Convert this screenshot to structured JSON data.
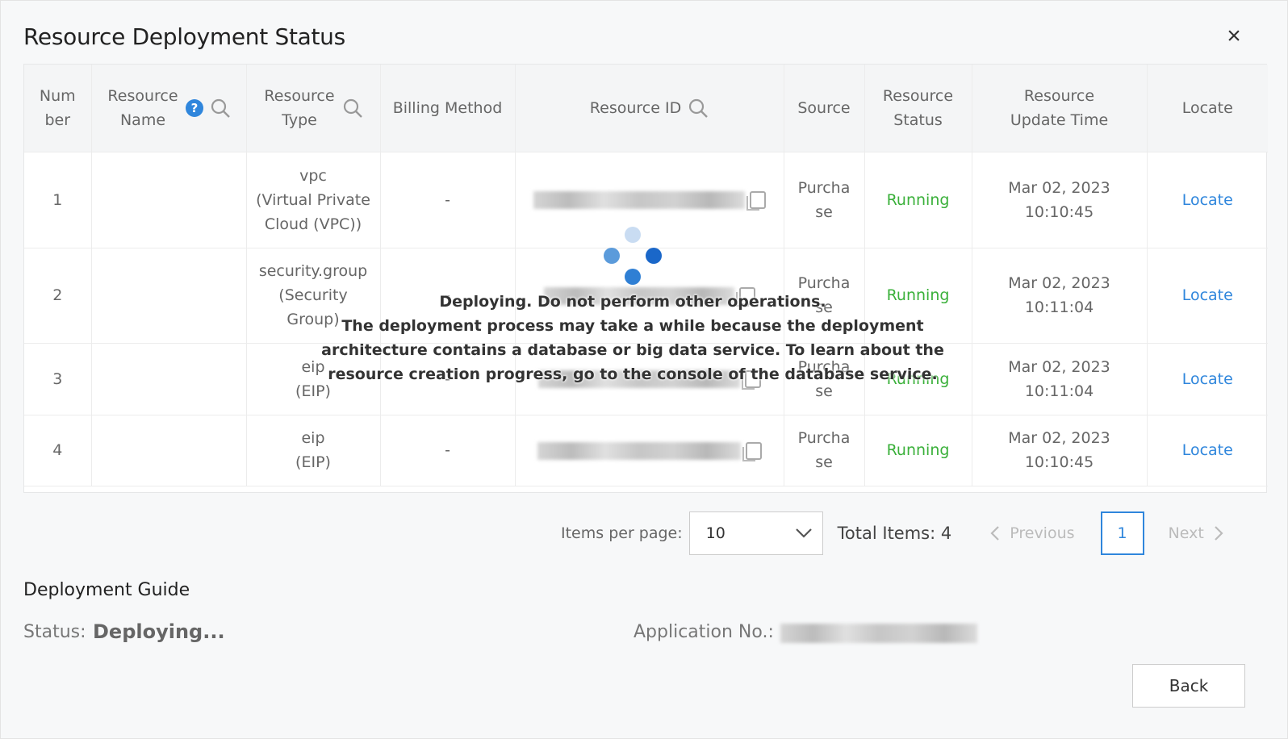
{
  "dialog": {
    "title": "Resource Deployment Status",
    "close_label": "×"
  },
  "table": {
    "headers": {
      "number": "Num ber",
      "resource_name": "Resource Name",
      "resource_type": "Resource Type",
      "billing_method": "Billing Method",
      "resource_id": "Resource ID",
      "source": "Source",
      "resource_status": "Resource Status",
      "update_time": "Resource Update Time",
      "locate": "Locate"
    },
    "rows": [
      {
        "number": "1",
        "resource_name": "",
        "type_line1": "vpc",
        "type_line2": "(Virtual Private",
        "type_line3": "Cloud (VPC))",
        "billing": "-",
        "source": "Purchase",
        "status": "Running",
        "time": "Mar 02, 2023 10:10:45",
        "locate": "Locate"
      },
      {
        "number": "2",
        "resource_name": "",
        "type_line1": "security.group",
        "type_line2": "(Security",
        "type_line3": "Group)",
        "billing": "-",
        "source": "Purchase",
        "status": "Running",
        "time": "Mar 02, 2023 10:11:04",
        "locate": "Locate"
      },
      {
        "number": "3",
        "resource_name": "",
        "type_line1": "eip",
        "type_line2": "(EIP)",
        "type_line3": "",
        "billing": "-",
        "source": "Purchase",
        "status": "Running",
        "time": "Mar 02, 2023 10:11:04",
        "locate": "Locate"
      },
      {
        "number": "4",
        "resource_name": "",
        "type_line1": "eip",
        "type_line2": "(EIP)",
        "type_line3": "",
        "billing": "-",
        "source": "Purchase",
        "status": "Running",
        "time": "Mar 02, 2023 10:10:45",
        "locate": "Locate"
      }
    ]
  },
  "overlay": {
    "line1": "Deploying. Do not perform other operations.",
    "line2": "The deployment process may take a while because the deployment",
    "line3": "architecture contains a database or big data service. To learn about the",
    "line4": "resource creation progress, go to the console of the database service."
  },
  "pagination": {
    "items_per_page_label": "Items per page:",
    "items_per_page_value": "10",
    "total_label": "Total Items: 4",
    "previous_label": "Previous",
    "current_page": "1",
    "next_label": "Next"
  },
  "guide": {
    "heading": "Deployment Guide",
    "status_label": "Status:",
    "status_value": "Deploying...",
    "application_no_label": "Application No.:"
  },
  "footer": {
    "back_label": "Back"
  },
  "colors": {
    "accent": "#2f86dc",
    "running": "#3ab03a",
    "spinner_light": "#c9dcf2",
    "spinner_mid": "#5b9bdb",
    "spinner_dark": "#1a67c9"
  },
  "icons": [
    "close-icon",
    "help-icon",
    "search-icon",
    "copy-icon",
    "chevron-down-icon",
    "chevron-left-icon",
    "chevron-right-icon",
    "loading-spinner"
  ]
}
